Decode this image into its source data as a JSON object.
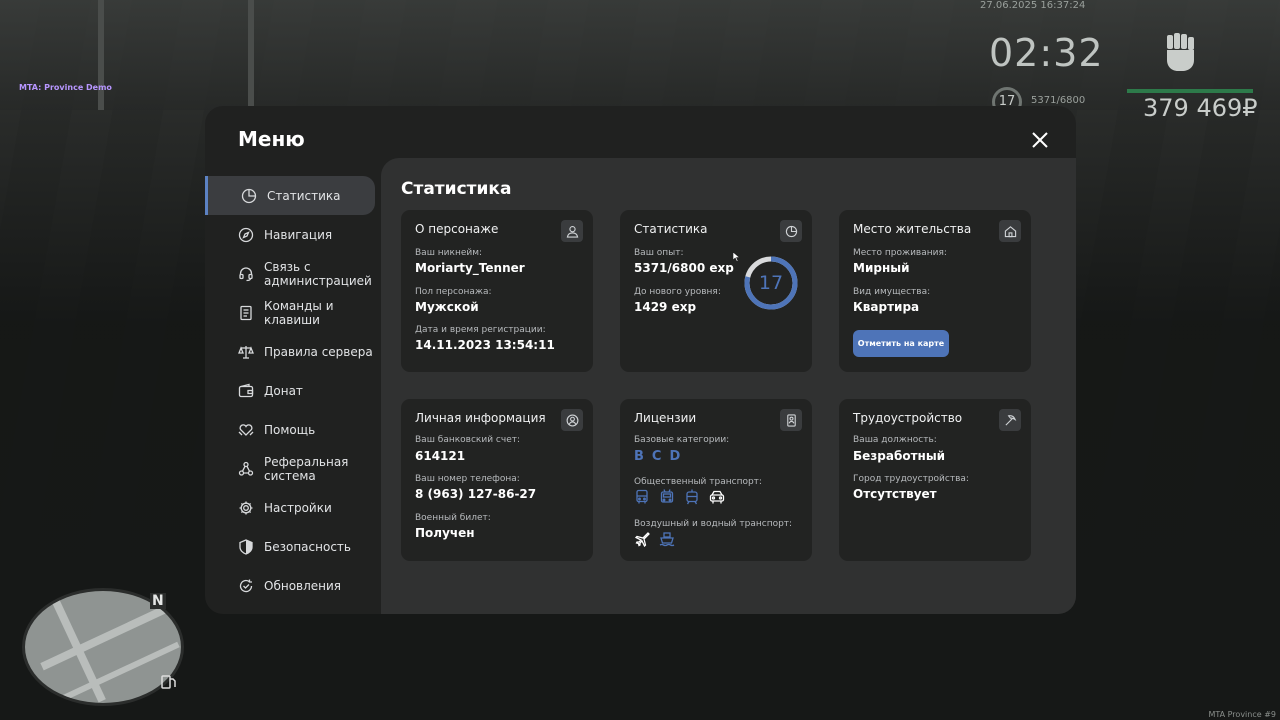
{
  "hud": {
    "datetime": "27.06.2025 16:37:24",
    "brand": "MTA: Province Demo",
    "clock": "02:32",
    "level": "17",
    "exp": "5371/6800",
    "money": "379 469₽",
    "map_north": "N",
    "watermark": "MTA Province #9"
  },
  "menu": {
    "title": "Меню",
    "sidebar": [
      {
        "label": "Статистика",
        "icon": "pie-chart-icon",
        "active": true
      },
      {
        "label": "Навигация",
        "icon": "compass-icon"
      },
      {
        "label": "Связь с администрацией",
        "icon": "headset-icon"
      },
      {
        "label": "Команды и клавиши",
        "icon": "document-icon"
      },
      {
        "label": "Правила сервера",
        "icon": "scales-icon"
      },
      {
        "label": "Донат",
        "icon": "wallet-icon"
      },
      {
        "label": "Помощь",
        "icon": "heart-hands-icon"
      },
      {
        "label": "Реферальная система",
        "icon": "network-icon"
      },
      {
        "label": "Настройки",
        "icon": "gear-icon"
      },
      {
        "label": "Безопасность",
        "icon": "shield-icon"
      },
      {
        "label": "Обновления",
        "icon": "refresh-check-icon"
      }
    ],
    "section_title": "Статистика",
    "cards": {
      "character": {
        "title": "О персонаже",
        "nickname_label": "Ваш никнейм:",
        "nickname": "Moriarty_Tenner",
        "gender_label": "Пол персонажа:",
        "gender": "Мужской",
        "reg_label": "Дата и время регистрации:",
        "reg": "14.11.2023 13:54:11"
      },
      "stats": {
        "title": "Статистика",
        "exp_label": "Ваш опыт:",
        "exp": "5371/6800 exp",
        "next_label": "До нового уровня:",
        "next": "1429 exp",
        "level": "17",
        "progress": 0.79
      },
      "residence": {
        "title": "Место жительства",
        "place_label": "Место проживания:",
        "place": "Мирный",
        "property_label": "Вид имущества:",
        "property": "Квартира",
        "map_button": "Отметить на карте"
      },
      "personal": {
        "title": "Личная информация",
        "bank_label": "Ваш банковский счет:",
        "bank": "614121",
        "phone_label": "Ваш номер телефона:",
        "phone": "8 (963) 127-86-27",
        "military_label": "Военный билет:",
        "military": "Получен"
      },
      "licenses": {
        "title": "Лицензии",
        "basic_label": "Базовые категории:",
        "basic": [
          "B",
          "C",
          "D"
        ],
        "public_label": "Общественный транспорт:",
        "air_label": "Воздушный и водный транспорт:"
      },
      "job": {
        "title": "Трудоустройство",
        "position_label": "Ваша должность:",
        "position": "Безработный",
        "city_label": "Город трудоустройства:",
        "city": "Отсутствует"
      }
    }
  },
  "colors": {
    "accent": "#4e74b8",
    "panel": "#202120",
    "content": "#303131",
    "card": "#222322"
  }
}
